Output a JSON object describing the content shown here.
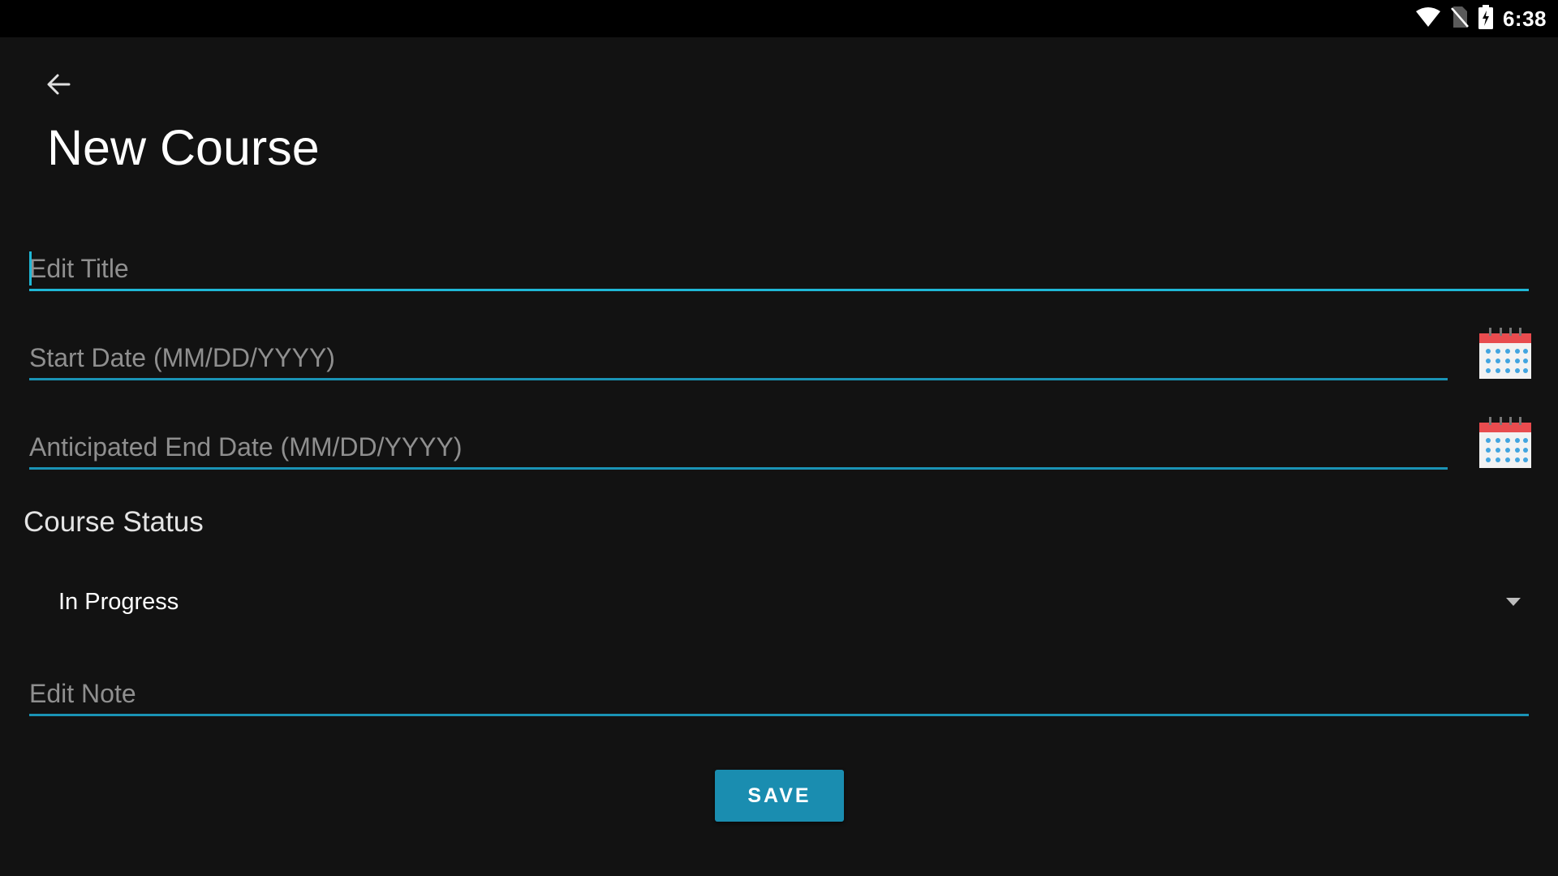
{
  "status_bar": {
    "time": "6:38",
    "icons": [
      "wifi-icon",
      "no-sim-icon",
      "battery-charging-icon"
    ]
  },
  "toolbar": {
    "back_icon": "arrow-back-icon",
    "title": "New Course"
  },
  "form": {
    "title_field": {
      "placeholder": "Edit Title",
      "value": ""
    },
    "start_date_field": {
      "placeholder": "Start Date (MM/DD/YYYY)",
      "value": "",
      "icon": "calendar-icon"
    },
    "end_date_field": {
      "placeholder": "Anticipated End Date (MM/DD/YYYY)",
      "value": "",
      "icon": "calendar-icon"
    },
    "status_label": "Course Status",
    "status_dropdown": {
      "selected": "In Progress",
      "icon": "dropdown-arrow-icon"
    },
    "note_field": {
      "placeholder": "Edit Note",
      "value": ""
    },
    "save_label": "SAVE"
  },
  "colors": {
    "background": "#121212",
    "accent": "#1a93b5",
    "focus_accent": "#1fb7d6",
    "button": "#1a8db0",
    "calendar_header": "#e84c4f",
    "calendar_dots": "#42a5e0"
  }
}
